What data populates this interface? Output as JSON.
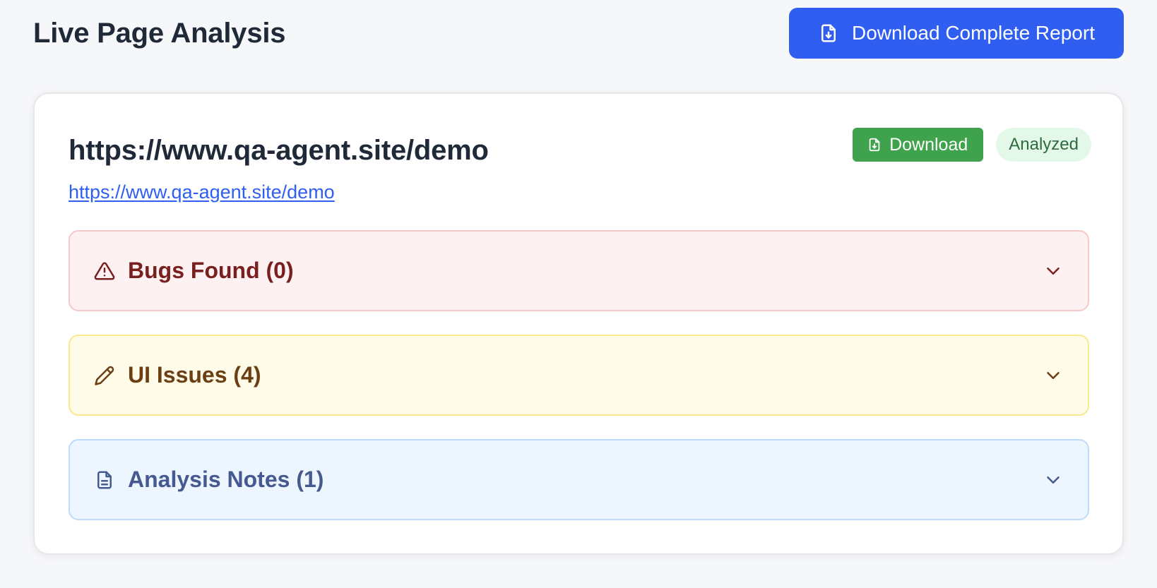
{
  "header": {
    "title": "Live Page Analysis",
    "report_button_label": "Download Complete Report",
    "report_button_icon": "file-download-icon"
  },
  "card": {
    "title": "https://www.qa-agent.site/demo",
    "link": "https://www.qa-agent.site/demo",
    "download_label": "Download",
    "status_badge": "Analyzed"
  },
  "sections": [
    {
      "label": "Bugs Found (0)",
      "icon": "warning-triangle-icon",
      "color": "#7a1f1f",
      "bg": "#fdf1f1"
    },
    {
      "label": "UI Issues (4)",
      "icon": "pencil-icon",
      "color": "#6b3f14",
      "bg": "#fefce9"
    },
    {
      "label": "Analysis Notes (1)",
      "icon": "document-icon",
      "color": "#465a91",
      "bg": "#edf5fe"
    }
  ],
  "colors": {
    "primary": "#2f5ef0",
    "success": "#3fa34d",
    "badge_bg": "#e3f8e9"
  }
}
